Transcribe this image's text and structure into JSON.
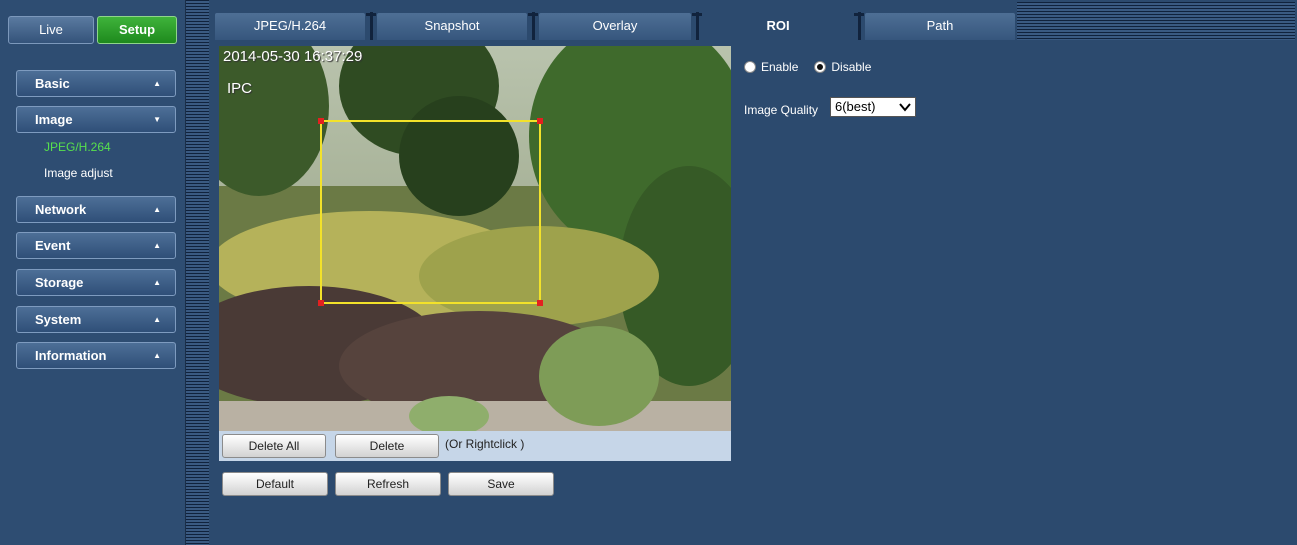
{
  "sidebar": {
    "mode_live": "Live",
    "mode_setup": "Setup",
    "menus": {
      "basic": "Basic",
      "image": "Image",
      "network": "Network",
      "event": "Event",
      "storage": "Storage",
      "system": "System",
      "information": "Information"
    },
    "submenu": {
      "jpeg": "JPEG/H.264",
      "adjust": "Image adjust"
    },
    "caret_up": "▲",
    "caret_down": "▼"
  },
  "tabs": {
    "jpeg": "JPEG/H.264",
    "snapshot": "Snapshot",
    "overlay": "Overlay",
    "roi": "ROI",
    "path": "Path"
  },
  "video": {
    "timestamp": "2014-05-30 16:37:29",
    "camera_name": "IPC"
  },
  "roi_toolbar": {
    "delete_all": "Delete All",
    "delete": "Delete",
    "hint": "(Or Rightclick )"
  },
  "actions": {
    "default": "Default",
    "refresh": "Refresh",
    "save": "Save"
  },
  "roi_settings": {
    "enable_label": "Enable",
    "disable_label": "Disable",
    "selected": "Disable",
    "image_quality_label": "Image Quality",
    "image_quality_value": "6(best)"
  },
  "colors": {
    "accent_green": "#3fb33b",
    "active_submenu": "#57e04d",
    "roi_border": "#f3e22a",
    "roi_handle": "#e32020",
    "panel_bg": "#2c4a6e"
  }
}
